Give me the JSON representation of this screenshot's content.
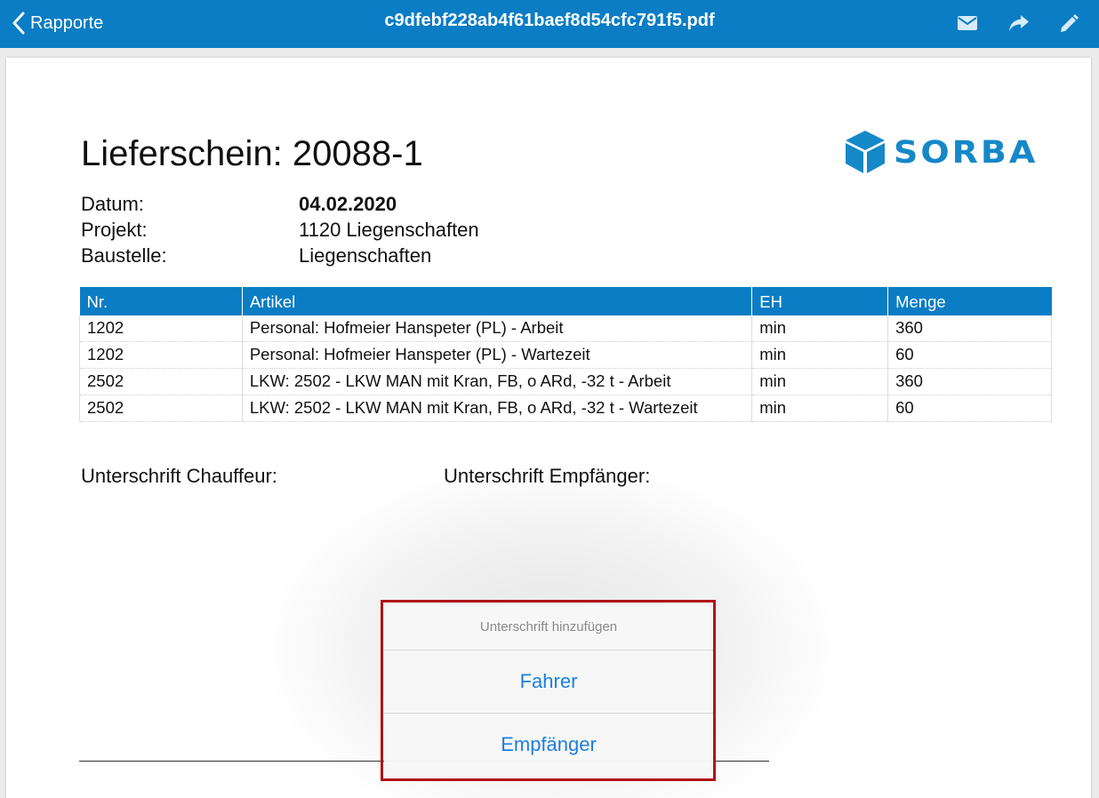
{
  "nav": {
    "back_label": "Rapporte",
    "title": "c9dfebf228ab4f61baef8d54cfc791f5.pdf",
    "actions": [
      "mail-icon",
      "share-icon",
      "edit-icon"
    ]
  },
  "document": {
    "title": "Lieferschein: 20088-1",
    "logo_text": "SORBA",
    "logo_color": "#1588c8",
    "meta": [
      {
        "label": "Datum:",
        "value": "04.02.2020",
        "bold": true
      },
      {
        "label": "Projekt:",
        "value": "1120 Liegenschaften",
        "bold": false
      },
      {
        "label": "Baustelle:",
        "value": "Liegenschaften",
        "bold": false
      }
    ],
    "table": {
      "headers": [
        "Nr.",
        "Artikel",
        "EH",
        "Menge"
      ],
      "rows": [
        [
          "1202",
          "Personal: Hofmeier Hanspeter (PL) - Arbeit",
          "min",
          "360"
        ],
        [
          "1202",
          "Personal: Hofmeier Hanspeter (PL) - Wartezeit",
          "min",
          "60"
        ],
        [
          "2502",
          "LKW: 2502 - LKW MAN mit Kran, FB, o ARd, -32 t - Arbeit",
          "min",
          "360"
        ],
        [
          "2502",
          "LKW: 2502 - LKW MAN mit Kran, FB, o ARd, -32 t - Wartezeit",
          "min",
          "60"
        ]
      ]
    },
    "signature_driver_label": "Unterschrift Chauffeur:",
    "signature_recipient_label": "Unterschrift Empfänger:"
  },
  "popover": {
    "title": "Unterschrift hinzufügen",
    "options": [
      "Fahrer",
      "Empfänger"
    ]
  },
  "colors": {
    "nav_bar": "#0a7dc4",
    "table_header": "#0a7dc4",
    "action_text": "#1d7fe0",
    "highlight_border": "#b0141a"
  }
}
